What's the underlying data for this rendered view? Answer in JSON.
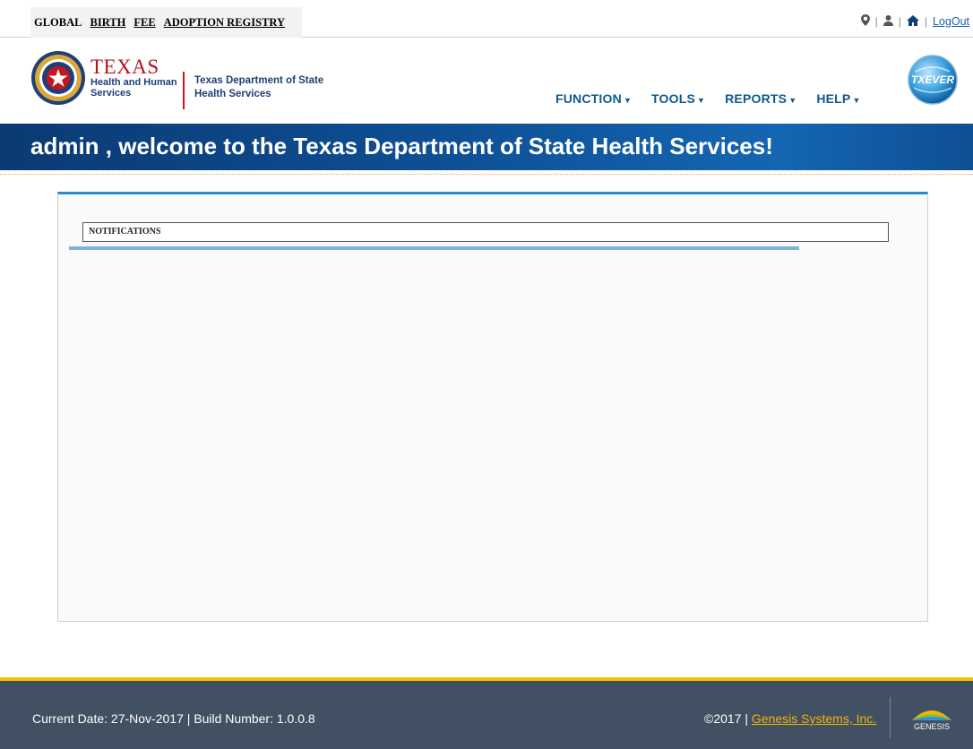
{
  "tabs": [
    "GLOBAL",
    "BIRTH",
    "FEE",
    "ADOPTION REGISTRY"
  ],
  "utility": {
    "icons": [
      "map-marker-icon",
      "user-icon",
      "home-icon"
    ],
    "separator": "|",
    "logout": "LogOut"
  },
  "header": {
    "hhs_title": "TEXAS",
    "hhs_line2": "Health and Human",
    "hhs_line3": "Services",
    "dshs_line1": "Texas Department of State",
    "dshs_line2": "Health Services",
    "globe_text": "TXEVER"
  },
  "menu": [
    "FUNCTION",
    "TOOLS",
    "REPORTS",
    "HELP"
  ],
  "banner": {
    "welcome": "admin , welcome to the Texas Department of State Health Services!"
  },
  "main": {
    "notifications_label": "NOTIFICATIONS"
  },
  "footer": {
    "date_build": "Current Date: 27-Nov-2017 | Build Number: 1.0.0.8",
    "copyright": "©2017 | ",
    "company": "Genesis Systems, Inc.",
    "logo_text": "GENESIS"
  },
  "colors": {
    "banner": "#0e4f94",
    "menu": "#0e5a8e",
    "footer": "#415063",
    "footer_accent": "#f2c000",
    "panel_accent": "#2a8ccc"
  }
}
